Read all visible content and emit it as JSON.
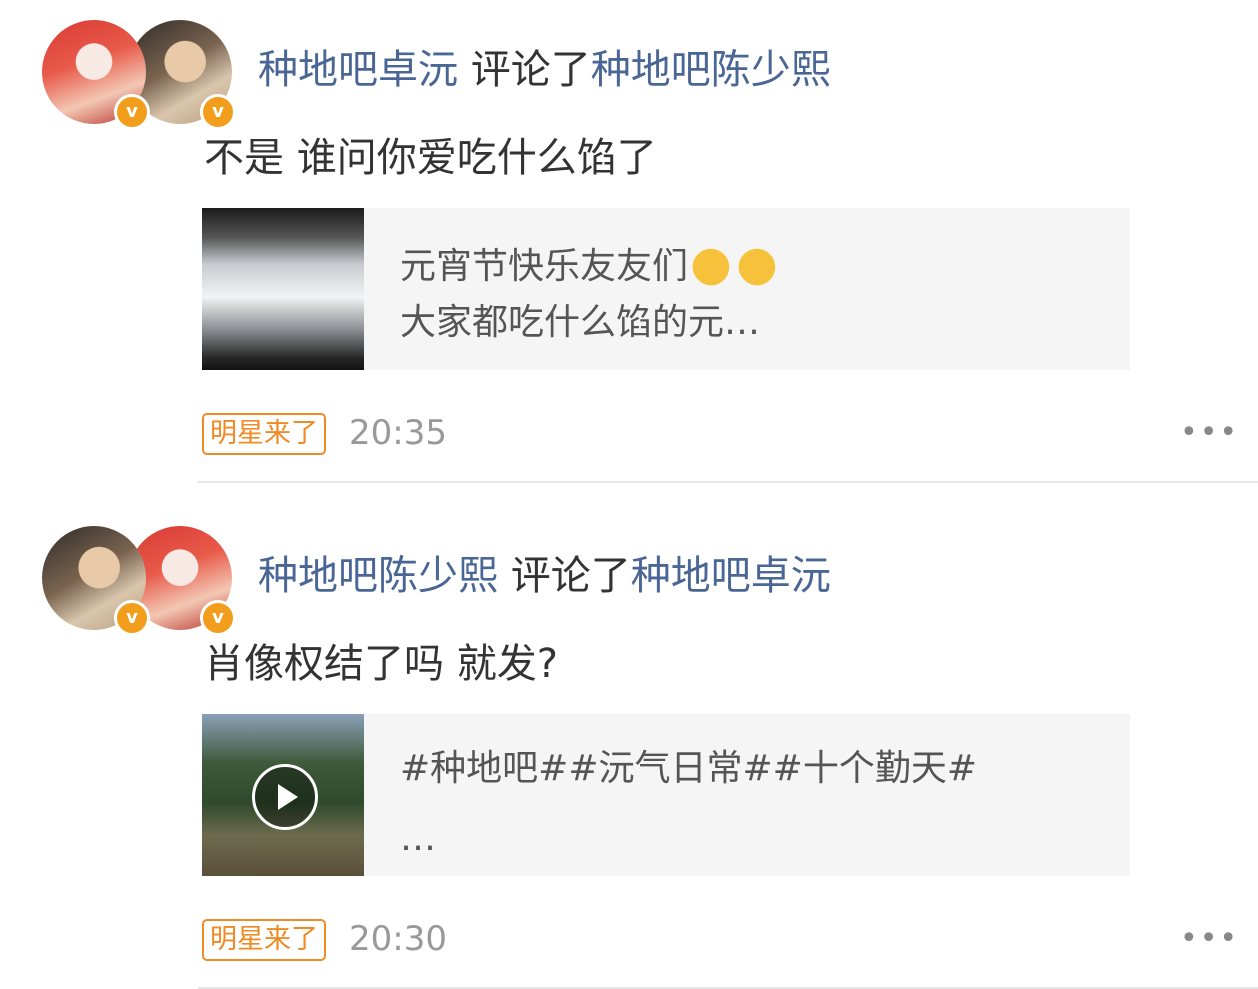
{
  "feed": [
    {
      "commenter": "种地吧卓沅",
      "verb": "评论了",
      "target": "种地吧陈少熙",
      "avatar_front": "avatar-zhuoyuan",
      "avatar_back": "avatar-chenshaoxi",
      "comment": "不是 谁问你爱吃什么馅了",
      "card_line1": "元宵节快乐友友们",
      "card_line2": "大家都吃什么馅的元…",
      "card_has_video": false,
      "tag": "明星来了",
      "time": "20:35",
      "more": "•••"
    },
    {
      "commenter": "种地吧陈少熙",
      "verb": "评论了",
      "target": "种地吧卓沅",
      "avatar_front": "avatar-chenshaoxi",
      "avatar_back": "avatar-zhuoyuan",
      "comment": "肖像权结了吗 就发?",
      "card_line1": "#种地吧##沅气日常##十个勤天#",
      "card_line2": "…",
      "card_has_video": true,
      "tag": "明星来了",
      "time": "20:30",
      "more": "•••"
    }
  ],
  "icons": {
    "verified": "v",
    "clap": "clapping-hands-icon",
    "play": "play-icon",
    "more": "more-icon"
  },
  "colors": {
    "name_link": "#4a6695",
    "tag_orange": "#f08a24",
    "verified_badge": "#f29d1c",
    "time_gray": "#999999",
    "card_bg": "#f5f5f5"
  }
}
